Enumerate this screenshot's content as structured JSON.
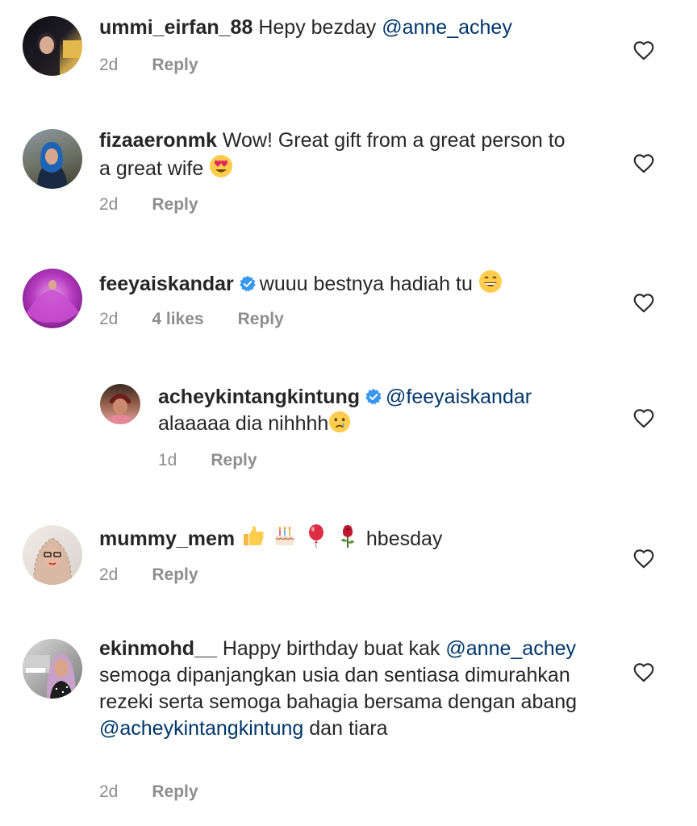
{
  "comments": [
    {
      "username": "ummi_eirfan_88",
      "text": "Hepy bezday",
      "mention": "@anne_achey",
      "time": "2d",
      "reply": "Reply"
    },
    {
      "username": "fizaaeronmk",
      "text": "Wow! Great gift from a great person to a great wife",
      "emoji": "heart-eyes-emoji",
      "time": "2d",
      "reply": "Reply"
    },
    {
      "username": "feeyaiskandar",
      "verified": true,
      "text": "wuuu bestnya hadiah tu",
      "emoji": "grinning-emoji",
      "time": "2d",
      "likes": "4 likes",
      "reply": "Reply"
    },
    {
      "username": "acheykintangkintung",
      "verified": true,
      "mention": "@feeyaiskandar",
      "text": "alaaaaa dia nihhhh",
      "emoji": "crying-emoji",
      "time": "1d",
      "reply": "Reply",
      "is_reply": true
    },
    {
      "username": "mummy_mem",
      "emojis": [
        "thumbs-up-emoji",
        "birthday-cake-emoji",
        "balloon-emoji",
        "rose-emoji"
      ],
      "text": "hbesday",
      "time": "2d",
      "reply": "Reply"
    },
    {
      "username": "ekinmohd__",
      "text_a": "Happy birthday buat kak",
      "mention_a": "@anne_achey",
      "text_b": "semoga dipanjangkan usia dan sentiasa dimurahkan rezeki serta semoga bahagia bersama dengan abang",
      "mention_b": "@acheykintangkintung",
      "text_c": "dan tiara",
      "time": "2d",
      "reply": "Reply"
    }
  ],
  "colors": {
    "mention": "#00376b",
    "meta": "#8e8e8e",
    "verified": "#3897f0"
  }
}
